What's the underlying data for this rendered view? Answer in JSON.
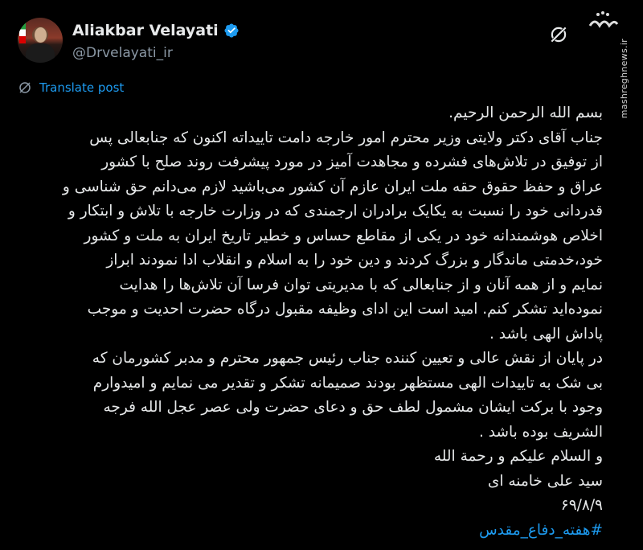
{
  "author": {
    "display_name": "Aliakbar Velayati",
    "handle": "@Drvelayati_ir",
    "verified": true,
    "avatar_icon": "profile-photo"
  },
  "actions": {
    "translate_label": "Translate post",
    "translate_icon": "globe-translate-icon",
    "grok_icon": "grok-icon"
  },
  "watermark": {
    "logo": "مشرق",
    "site": "mashreghnews.ir"
  },
  "post": {
    "lines": [
      "بسم الله الرحمن الرحیم.",
      "جناب آقای دکتر ولایتی وزیر محترم امور خارجه دامت تاییداته اکنون که جنابعالی پس",
      "از توفیق در تلاش‌های فشرده و مجاهدت آمیز در مورد پیشرفت روند صلح با کشور",
      "عراق و حفظ حقوق حقه ملت ایران عازم آن کشور می‌باشید لازم می‌دانم حق شناسی و",
      "قدردانی خود را نسبت به یکایک برادران ارجمندی که در وزارت خارجه با تلاش و ابتکار و",
      "اخلاص هوشمندانه خود در یکی از مقاطع حساس و خطیر تاریخ ایران به ملت و کشور",
      "خود،خدمتی ماندگار و بزرگ کردند و دین خود را به اسلام و انقلاب ادا نمودند ابراز",
      "نمایم و از همه آنان و از جنابعالی که با مدیریتی توان فرسا آن تلاش‌ها را هدایت",
      "نموده‌اید تشکر کنم. امید است این ادای وظیفه مقبول درگاه حضرت احدیت و موجب",
      "پاداش الهی باشد .",
      "در پایان از نقش عالی و تعیین کننده جناب رئیس جمهور محترم و مدبر کشورمان که",
      "بی شک به تاییدات الهی مستظهر بودند صمیمانه تشکر و تقدیر می نمایم و امیدوارم",
      "وجود با برکت ایشان مشمول لطف حق و دعای حضرت ولی عصر عجل الله فرجه",
      "الشریف بوده باشد .",
      "و السلام علیکم و رحمة الله",
      "سید علی خامنه ای",
      "۶۹/۸/۹"
    ],
    "hashtag": "#هفته_دفاع_مقدس"
  },
  "colors": {
    "background": "#000000",
    "text": "#e7e9ea",
    "secondary": "#8b98a5",
    "accent": "#1d9bf0"
  }
}
